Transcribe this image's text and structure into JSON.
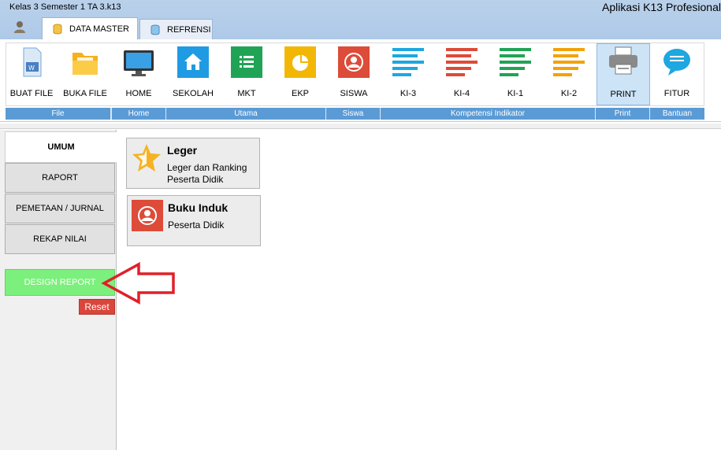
{
  "window": {
    "title": "Kelas 3 Semester 1 TA 3.k13",
    "app_title": "Aplikasi K13 Profesional"
  },
  "tabs": [
    {
      "label": "DATA MASTER",
      "icon": "database-icon",
      "active": true
    },
    {
      "label": "REFRENSI",
      "icon": "database-icon",
      "active": false
    }
  ],
  "ribbon": {
    "buttons": [
      {
        "label": "BUAT FILE",
        "icon": "new-file-icon"
      },
      {
        "label": "BUKA FILE",
        "icon": "open-folder-icon"
      },
      {
        "label": "HOME",
        "icon": "monitor-icon"
      },
      {
        "label": "SEKOLAH",
        "icon": "home-icon"
      },
      {
        "label": "MKT",
        "icon": "list-icon"
      },
      {
        "label": "EKP",
        "icon": "pie-chart-icon"
      },
      {
        "label": "SISWA",
        "icon": "user-icon"
      },
      {
        "label": "KI-3",
        "icon": "lines-icon"
      },
      {
        "label": "KI-4",
        "icon": "lines-icon"
      },
      {
        "label": "KI-1",
        "icon": "lines-icon"
      },
      {
        "label": "KI-2",
        "icon": "lines-icon"
      },
      {
        "label": "PRINT",
        "icon": "printer-icon"
      },
      {
        "label": "FITUR",
        "icon": "chat-bubble-icon"
      }
    ],
    "groups": [
      "File",
      "Home",
      "Utama",
      "Siswa",
      "Kompetensi Indikator",
      "Print",
      "Bantuan"
    ]
  },
  "sidebar": {
    "items": [
      {
        "label": "UMUM",
        "active": true
      },
      {
        "label": "RAPORT"
      },
      {
        "label": "PEMETAAN / JURNAL"
      },
      {
        "label": "REKAP NILAI"
      }
    ],
    "design_report": "DESIGN REPORT",
    "reset": "Reset"
  },
  "tiles": [
    {
      "title": "Leger",
      "desc": "Leger dan Ranking Peserta Didik",
      "icon": "star-icon"
    },
    {
      "title": "Buku Induk",
      "desc": "Peserta Didik",
      "icon": "user-icon"
    }
  ],
  "colors": {
    "accent_blue": "#5b9bd5",
    "green_button": "#7cf07c",
    "reset_red": "#d9463b",
    "arrow_red": "#e0202a"
  }
}
